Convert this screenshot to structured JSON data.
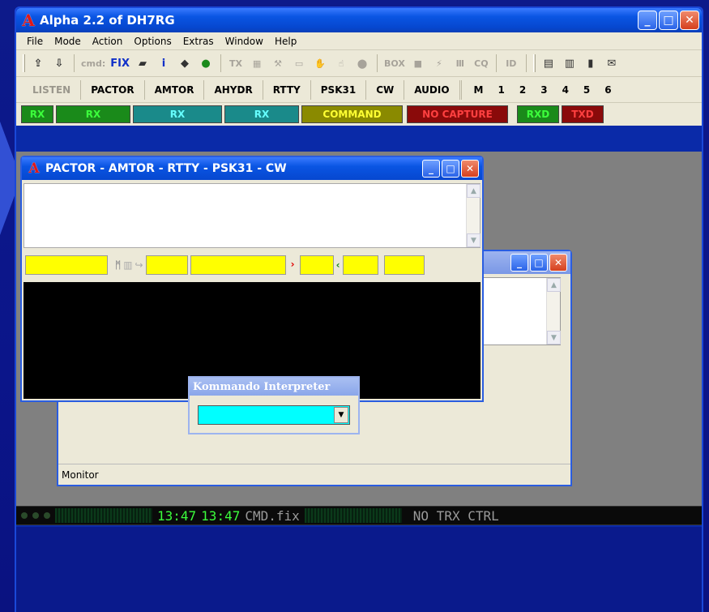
{
  "app": {
    "title": "Alpha 2.2 of DH7RG",
    "icon": "alpha-a-icon"
  },
  "menu": [
    "File",
    "Mode",
    "Action",
    "Options",
    "Extras",
    "Window",
    "Help"
  ],
  "toolbar": {
    "text_icons": {
      "cmd": "cmd:",
      "fix": "FIX",
      "info": "i",
      "tx": "TX",
      "box": "BOX",
      "cq": "CQ",
      "id": "ID"
    }
  },
  "modes": {
    "listen": "LISTEN",
    "pactor": "PACTOR",
    "amtor": "AMTOR",
    "ahyor": "AHYDR",
    "rtty": "RTTY",
    "psk31": "PSK31",
    "cw": "CW",
    "audio": "AUDIO",
    "numbers": [
      "M",
      "1",
      "2",
      "3",
      "4",
      "5",
      "6"
    ]
  },
  "status": [
    {
      "label": "RX",
      "bg": "#1a8a1a",
      "fg": "#3cff3c"
    },
    {
      "label": "RX",
      "bg": "#1a8a1a",
      "fg": "#3cff3c"
    },
    {
      "label": "RX",
      "bg": "#1a8a8a",
      "fg": "#6ff"
    },
    {
      "label": "RX",
      "bg": "#1a8a8a",
      "fg": "#6ff"
    },
    {
      "label": "COMMAND",
      "bg": "#8a8a00",
      "fg": "#ff3"
    },
    {
      "label": "NO CAPTURE",
      "bg": "#8a0a0a",
      "fg": "#ff4040"
    },
    {
      "label": "RXD",
      "bg": "#1a8a1a",
      "fg": "#3cff3c"
    },
    {
      "label": "TXD",
      "bg": "#8a0a0a",
      "fg": "#ff4040"
    }
  ],
  "pactor_window": {
    "title": "PACTOR - AMTOR - RTTY - PSK31 - CW"
  },
  "monitor_window": {
    "label": "Monitor"
  },
  "command_interpreter": {
    "title": "Kommando Interpreter"
  },
  "bottom": {
    "time1": "13:47",
    "time2": "13:47",
    "file": "CMD.fix",
    "trx": "NO TRX CTRL"
  }
}
